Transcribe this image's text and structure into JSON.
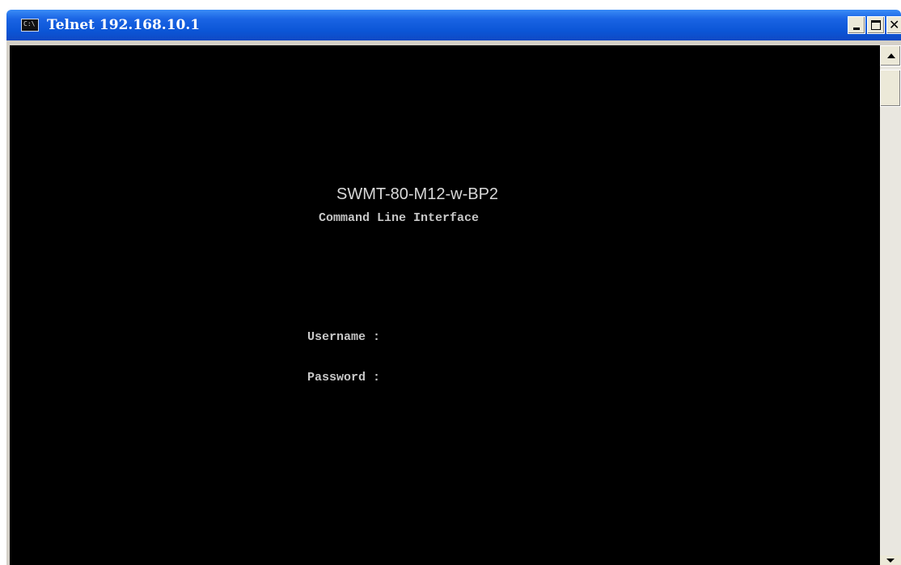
{
  "window": {
    "title": "Telnet 192.168.10.1",
    "title_icon": "console-icon",
    "buttons": {
      "minimize_icon": "minimize-icon",
      "maximize_icon": "maximize-icon",
      "close_icon": "close-icon"
    },
    "colors": {
      "titlebar": "#0b55d6",
      "console_background": "#000000",
      "console_text": "#c8c8c8"
    }
  },
  "console": {
    "device_name": "SWMT-80-M12-w-BP2",
    "interface_title": "Command Line Interface",
    "username_prompt": "Username :",
    "password_prompt": "Password :"
  },
  "scrollbar": {
    "up_icon": "scroll-up-arrow-icon",
    "down_icon": "scroll-down-arrow-icon"
  }
}
